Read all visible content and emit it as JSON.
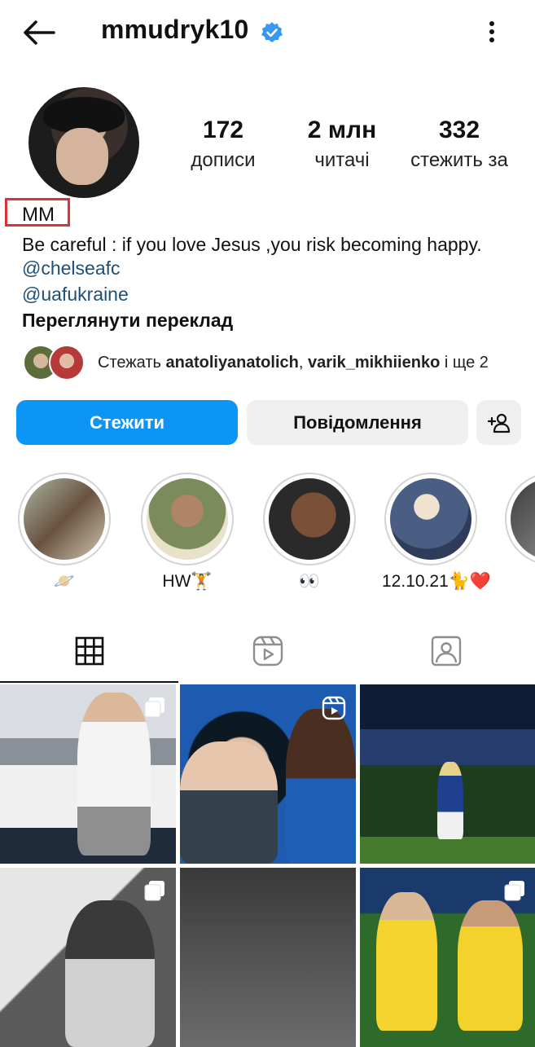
{
  "header": {
    "username": "mmudryk10",
    "verified": true
  },
  "profile": {
    "stats": [
      {
        "value": "172",
        "label": "дописи"
      },
      {
        "value": "2 млн",
        "label": "читачі"
      },
      {
        "value": "332",
        "label": "стежить за"
      }
    ],
    "name": "MM",
    "bio": "Be careful : if you love Jesus ,you risk becoming happy.",
    "links": [
      "@chelseafc",
      "@uafukraine"
    ],
    "translate_label": "Переглянути переклад",
    "mutuals": {
      "prefix": "Стежать ",
      "user1": "anatoliyanatolich",
      "separator": ", ",
      "user2": "varik_mikhiienko",
      "suffix": " і ще 2"
    }
  },
  "actions": {
    "follow_label": "Стежити",
    "message_label": "Повідомлення"
  },
  "highlights": [
    {
      "label": "🪐"
    },
    {
      "label": "HW🏋️"
    },
    {
      "label": "👀"
    },
    {
      "label": "12.10.21🐈❤️"
    },
    {
      "label": ""
    }
  ],
  "colors": {
    "follow_button": "#0d95f6",
    "link": "#1d4f78",
    "verified_badge": "#3897f0",
    "highlight_box": "#d9323a"
  },
  "icons": {
    "back": "arrow-left-icon",
    "more": "more-vertical-icon",
    "verified": "verified-badge-icon",
    "suggest": "add-user-icon",
    "tab_grid": "grid-icon",
    "tab_reels": "reels-icon",
    "tab_tagged": "tagged-icon"
  }
}
